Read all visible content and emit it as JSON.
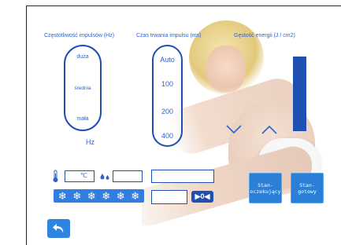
{
  "labels": {
    "frequency": "Częstotliwość impulsów (Hz)",
    "duration": "Czas trwania impulsu (ms)",
    "energy": "Gęstość energii (J / cm2)"
  },
  "frequency": {
    "options": [
      "duża",
      "średnia",
      "mała"
    ],
    "unit": "Hz"
  },
  "duration": {
    "options": [
      "Auto",
      "100",
      "200",
      "400"
    ]
  },
  "energy": {
    "color": "#1f4fb3"
  },
  "status": {
    "standby": "Stan-\noczekujący",
    "ready": "Stan-\ngotowy"
  },
  "temperature": {
    "unit": "℃",
    "value": ""
  },
  "water_level": {
    "value": ""
  },
  "cooling": {
    "icon": "snowflake-icon",
    "count": 6,
    "symbol": "❄"
  },
  "counter": {
    "label": "▶0◀",
    "value": ""
  },
  "accent_color": "#2f63c7"
}
